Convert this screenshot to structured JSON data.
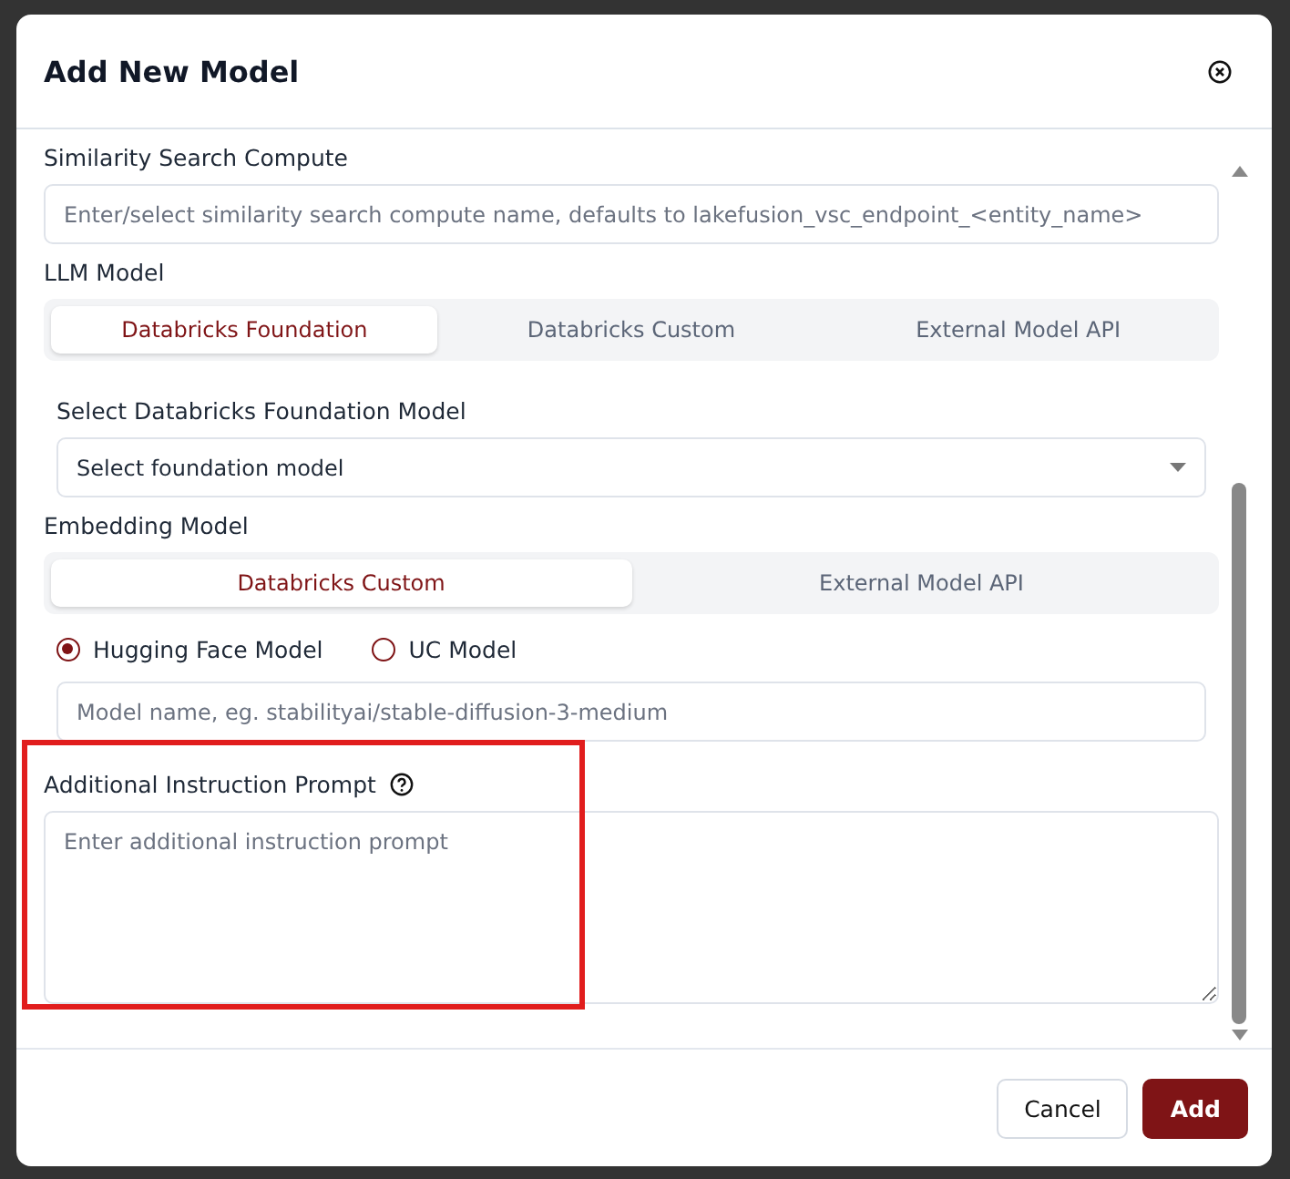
{
  "dialog": {
    "title": "Add New Model"
  },
  "similarity": {
    "label": "Similarity Search Compute",
    "placeholder": "Enter/select similarity search compute name, defaults to lakefusion_vsc_endpoint_<entity_name>"
  },
  "llm": {
    "label": "LLM Model",
    "tabs": [
      {
        "label": "Databricks Foundation",
        "selected": true
      },
      {
        "label": "Databricks Custom",
        "selected": false
      },
      {
        "label": "External Model API",
        "selected": false
      }
    ],
    "select_label": "Select Databricks Foundation Model",
    "select_value": "Select foundation model"
  },
  "embedding": {
    "label": "Embedding Model",
    "tabs": [
      {
        "label": "Databricks Custom",
        "selected": true
      },
      {
        "label": "External Model API",
        "selected": false
      }
    ],
    "radios": [
      {
        "label": "Hugging Face Model",
        "selected": true
      },
      {
        "label": "UC Model",
        "selected": false
      }
    ],
    "placeholder": "Model name, eg. stabilityai/stable-diffusion-3-medium"
  },
  "prompt": {
    "label": "Additional Instruction Prompt",
    "placeholder": "Enter additional instruction prompt"
  },
  "buttons": [
    {
      "label": "Cancel",
      "kind": "secondary"
    },
    {
      "label": "Add",
      "kind": "primary"
    }
  ]
}
